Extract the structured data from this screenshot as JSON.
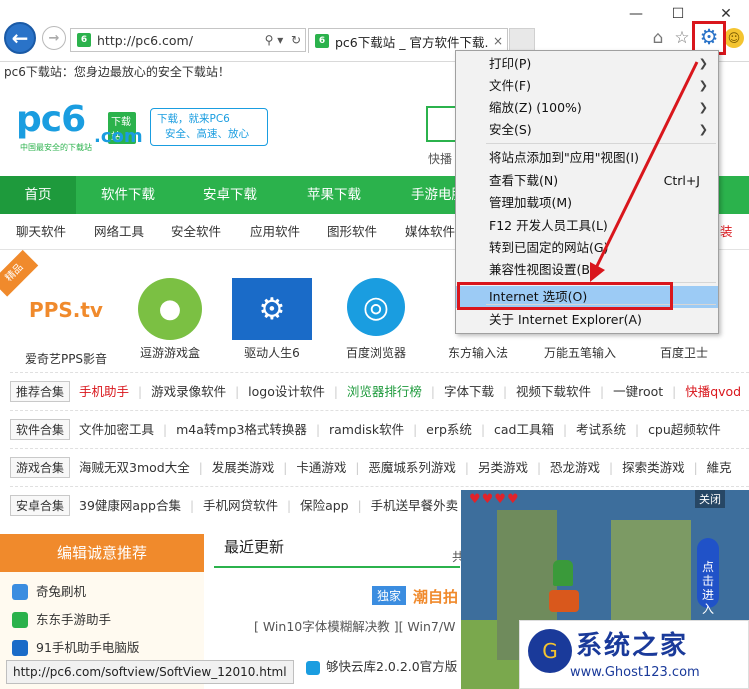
{
  "browser": {
    "address_url": "http://pc6.com/",
    "tab_title": "pc6下载站 _ 官方软件下载...",
    "back_glyph": "←",
    "forward_glyph": "→",
    "search_glyph": "⚲ ▾",
    "refresh_glyph": "↻",
    "tab_close": "×",
    "minimize": "—",
    "maximize": "☐",
    "close": "✕",
    "home_glyph": "⌂",
    "star_glyph": "☆",
    "gear_glyph": "⚙",
    "smile_glyph": "☺"
  },
  "page": {
    "slogan": "pc6下载站：您身边最放心的安全下载站！",
    "logo": {
      "main": "pc6",
      "badge": "下载站",
      "com": ".com",
      "tag": "中国最安全的下载站"
    },
    "bubble": {
      "line1": "下载，就来PC6",
      "line2": "安全、高速、放心"
    },
    "quick_fragment": "快播",
    "nav": [
      "首页",
      "软件下载",
      "安卓下载",
      "苹果下载",
      "手游电脑"
    ],
    "categories": [
      "聊天软件",
      "网络工具",
      "安全软件",
      "应用软件",
      "图形软件",
      "媒体软件"
    ],
    "cat_fragment": "装",
    "ribbon": "精品",
    "apps": [
      {
        "label": "爱奇艺PPS影音",
        "icon": "PPS.tv",
        "color": "#f08a2c"
      },
      {
        "label": "逗游游戏盒",
        "icon": "●",
        "color": "#7bc043"
      },
      {
        "label": "驱动人生6",
        "icon": "⚙",
        "color": "#1a6bc8"
      },
      {
        "label": "百度浏览器",
        "icon": "◎",
        "color": "#1a9de0"
      },
      {
        "label": "东方输入法",
        "icon": "",
        "color": "#ffffff"
      },
      {
        "label": "万能五笔输入",
        "icon": "",
        "color": "#ffffff"
      },
      {
        "label": "百度卫士",
        "icon": "",
        "color": "#ffffff"
      }
    ],
    "tag_rows": [
      {
        "name": "推荐合集",
        "tags": [
          {
            "t": "手机助手",
            "c": "red"
          },
          {
            "t": "游戏录像软件",
            "c": ""
          },
          {
            "t": "logo设计软件",
            "c": ""
          },
          {
            "t": "浏览器排行榜",
            "c": "green"
          },
          {
            "t": "字体下载",
            "c": ""
          },
          {
            "t": "视频下载软件",
            "c": ""
          },
          {
            "t": "一键root",
            "c": ""
          },
          {
            "t": "快播qvod",
            "c": "red"
          }
        ]
      },
      {
        "name": "软件合集",
        "tags": [
          {
            "t": "文件加密工具",
            "c": ""
          },
          {
            "t": "m4a转mp3格式转换器",
            "c": ""
          },
          {
            "t": "ramdisk软件",
            "c": ""
          },
          {
            "t": "erp系统",
            "c": ""
          },
          {
            "t": "cad工具箱",
            "c": ""
          },
          {
            "t": "考试系统",
            "c": ""
          },
          {
            "t": "cpu超频软件",
            "c": ""
          }
        ]
      },
      {
        "name": "游戏合集",
        "tags": [
          {
            "t": "海贼无双3mod大全",
            "c": ""
          },
          {
            "t": "发展类游戏",
            "c": ""
          },
          {
            "t": "卡通游戏",
            "c": ""
          },
          {
            "t": "恶魔城系列游戏",
            "c": ""
          },
          {
            "t": "另类游戏",
            "c": ""
          },
          {
            "t": "恐龙游戏",
            "c": ""
          },
          {
            "t": "探索类游戏",
            "c": ""
          },
          {
            "t": "維克",
            "c": ""
          }
        ]
      },
      {
        "name": "安卓合集",
        "tags": [
          {
            "t": "39健康网app合集",
            "c": ""
          },
          {
            "t": "手机网贷软件",
            "c": ""
          },
          {
            "t": "保险app",
            "c": ""
          },
          {
            "t": "手机送早餐外卖",
            "c": ""
          }
        ]
      }
    ],
    "left_panel": {
      "title": "编辑诚意推荐",
      "items": [
        "奇兔刷机",
        "东东手游助手",
        "91手机助手电脑版"
      ]
    },
    "latest": {
      "title": "最近更新",
      "exclusive": "独家",
      "exclusive_title": "潮自拍",
      "win10": "[ Win10字体模糊解决教 ][   Win7/W",
      "download_item": "够快云库2.0.2.0官方版",
      "gong": "共"
    },
    "status_url": "http://pc6.com/softview/SoftView_12010.html"
  },
  "ad": {
    "close": "关闭",
    "cta": "点击进入",
    "hearts": "♥♥♥♥",
    "brand_title": "系统之家",
    "brand_url": "www.Ghost123.com",
    "brand_logo": "G"
  },
  "menu": {
    "items": [
      {
        "label": "打印(P)",
        "shortcut": "",
        "arrow": true
      },
      {
        "label": "文件(F)",
        "shortcut": "",
        "arrow": true
      },
      {
        "label": "缩放(Z) (100%)",
        "shortcut": "",
        "arrow": true
      },
      {
        "label": "安全(S)",
        "shortcut": "",
        "arrow": true
      },
      {
        "label": "将站点添加到\"应用\"视图(I)",
        "shortcut": "",
        "arrow": false
      },
      {
        "label": "查看下载(N)",
        "shortcut": "Ctrl+J",
        "arrow": false
      },
      {
        "label": "管理加载项(M)",
        "shortcut": "",
        "arrow": false
      },
      {
        "label": "F12 开发人员工具(L)",
        "shortcut": "",
        "arrow": false
      },
      {
        "label": "转到已固定的网站(G)",
        "shortcut": "",
        "arrow": false
      },
      {
        "label": "兼容性视图设置(B)",
        "shortcut": "",
        "arrow": false
      },
      {
        "label": "Internet 选项(O)",
        "shortcut": "",
        "arrow": false
      },
      {
        "label": "关于 Internet Explorer(A)",
        "shortcut": "",
        "arrow": false
      }
    ],
    "arrow_glyph": "❯",
    "highlight_color": "#9ccbf5",
    "annotation_color": "#d9161c"
  }
}
